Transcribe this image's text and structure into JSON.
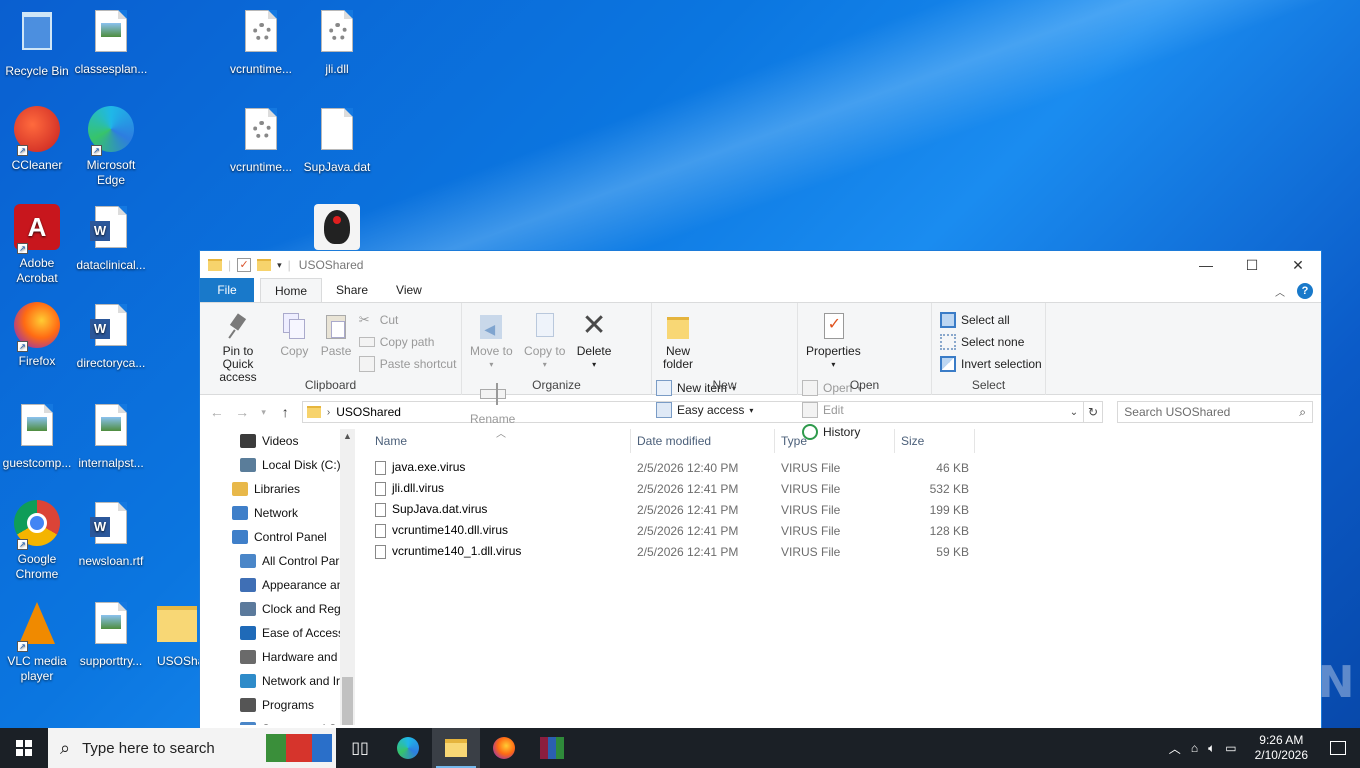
{
  "desktop": {
    "icons": [
      {
        "label": "Recycle Bin"
      },
      {
        "label": "classesplan..."
      },
      {
        "label": "vcruntime..."
      },
      {
        "label": "jli.dll"
      },
      {
        "label": "CCleaner"
      },
      {
        "label": "Microsoft Edge"
      },
      {
        "label": "vcruntime..."
      },
      {
        "label": "SupJava.dat"
      },
      {
        "label": "Adobe Acrobat"
      },
      {
        "label": "dataclinical..."
      },
      {
        "label": "Firefox"
      },
      {
        "label": "directoryca..."
      },
      {
        "label": "guestcomp..."
      },
      {
        "label": "internalpst..."
      },
      {
        "label": "Google Chrome"
      },
      {
        "label": "newsloan.rtf"
      },
      {
        "label": "VLC media player"
      },
      {
        "label": "supporttry..."
      },
      {
        "label": "USOSha"
      }
    ]
  },
  "window": {
    "title": "USOShared",
    "tabs": [
      "File",
      "Home",
      "Share",
      "View"
    ],
    "ribbon": {
      "clipboard": {
        "label": "Clipboard",
        "pin": "Pin to Quick access",
        "copy": "Copy",
        "paste": "Paste",
        "cut": "Cut",
        "copy_path": "Copy path",
        "paste_shortcut": "Paste shortcut"
      },
      "organize": {
        "label": "Organize",
        "move_to": "Move to",
        "copy_to": "Copy to",
        "delete": "Delete",
        "rename": "Rename"
      },
      "new": {
        "label": "New",
        "new_folder": "New folder",
        "new_item": "New item",
        "easy_access": "Easy access"
      },
      "open": {
        "label": "Open",
        "properties": "Properties",
        "open": "Open",
        "edit": "Edit",
        "history": "History"
      },
      "select": {
        "label": "Select",
        "select_all": "Select all",
        "select_none": "Select none",
        "invert": "Invert selection"
      }
    },
    "address": {
      "path": "USOShared",
      "search_placeholder": "Search USOShared"
    },
    "nav_items": [
      {
        "label": "Videos",
        "color": "#3b3b3b"
      },
      {
        "label": "Local Disk (C:)",
        "color": "#5a7d9a"
      },
      {
        "label": "Libraries",
        "color": "#e8b84a"
      },
      {
        "label": "Network",
        "color": "#3f7fc9"
      },
      {
        "label": "Control Panel",
        "color": "#3f7fc9"
      },
      {
        "label": "All Control Par",
        "color": "#4a86c8"
      },
      {
        "label": "Appearance an",
        "color": "#3f6fb5"
      },
      {
        "label": "Clock and Regi",
        "color": "#5b7a9c"
      },
      {
        "label": "Ease of Access",
        "color": "#1f6ab8"
      },
      {
        "label": "Hardware and",
        "color": "#6a6a6a"
      },
      {
        "label": "Network and Ir",
        "color": "#2e8bc9"
      },
      {
        "label": "Programs",
        "color": "#555555"
      },
      {
        "label": "System and S",
        "color": "#4a86c8"
      }
    ],
    "columns": {
      "name": "Name",
      "date": "Date modified",
      "type": "Type",
      "size": "Size"
    },
    "files": [
      {
        "name": "java.exe.virus",
        "date": "2/5/2026 12:40 PM",
        "type": "VIRUS File",
        "size": "46 KB"
      },
      {
        "name": "jli.dll.virus",
        "date": "2/5/2026 12:41 PM",
        "type": "VIRUS File",
        "size": "532 KB"
      },
      {
        "name": "SupJava.dat.virus",
        "date": "2/5/2026 12:41 PM",
        "type": "VIRUS File",
        "size": "199 KB"
      },
      {
        "name": "vcruntime140.dll.virus",
        "date": "2/5/2026 12:41 PM",
        "type": "VIRUS File",
        "size": "128 KB"
      },
      {
        "name": "vcruntime140_1.dll.virus",
        "date": "2/5/2026 12:41 PM",
        "type": "VIRUS File",
        "size": "59 KB"
      }
    ]
  },
  "taskbar": {
    "search_placeholder": "Type here to search",
    "time": "9:26 AM",
    "date": "2/10/2026"
  },
  "watermark": "ANY RUN"
}
